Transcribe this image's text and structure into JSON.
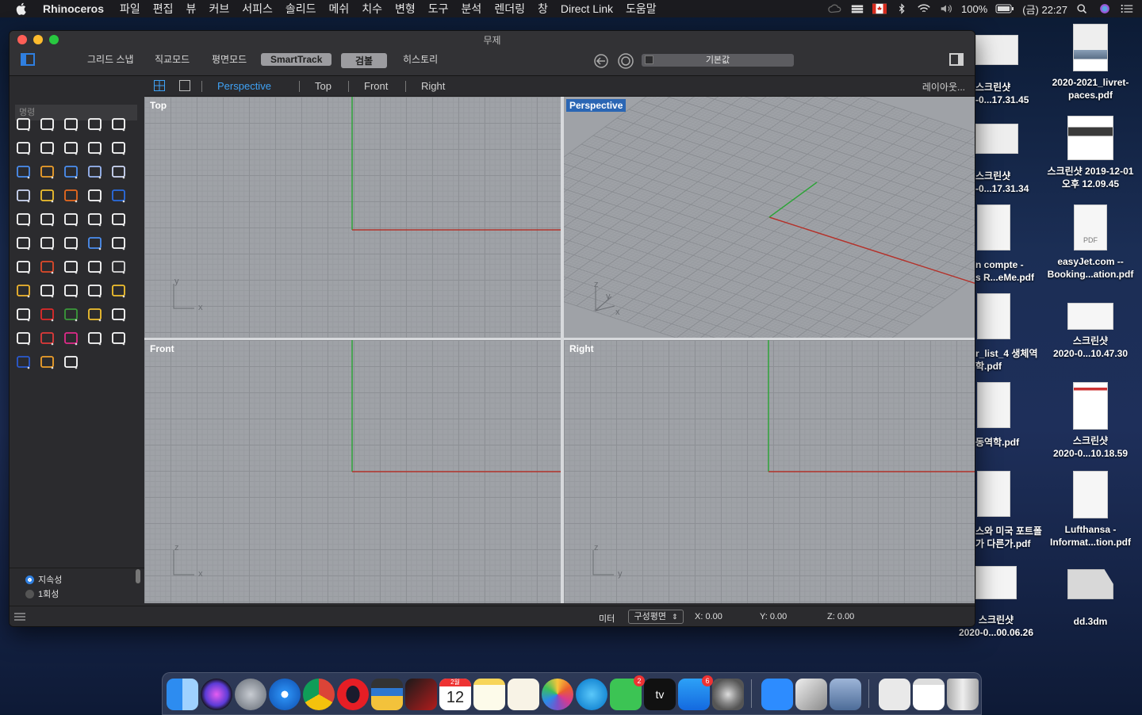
{
  "menubar": {
    "app": "Rhinoceros",
    "items": [
      "파일",
      "편집",
      "뷰",
      "커브",
      "서피스",
      "솔리드",
      "메쉬",
      "치수",
      "변형",
      "도구",
      "분석",
      "렌더링",
      "창",
      "Direct Link",
      "도움말"
    ],
    "battery": "100%",
    "clock": "(금) 22:27"
  },
  "window": {
    "title": "무제",
    "toolbar": {
      "grid_snap": "그리드 스냅",
      "ortho": "직교모드",
      "planar": "평면모드",
      "smarttrack": "SmartTrack",
      "gumball": "검볼",
      "history": "히스토리"
    },
    "layer": "기본값"
  },
  "sidebar": {
    "command_placeholder": "명령",
    "radio": [
      "지속성",
      "1회성"
    ]
  },
  "viewport_tabs": [
    "Perspective",
    "Top",
    "Front",
    "Right"
  ],
  "layout_button": "레이아웃...",
  "viewports": {
    "top": "Top",
    "perspective": "Perspective",
    "front": "Front",
    "right": "Right"
  },
  "axes": {
    "top": [
      "y",
      "x"
    ],
    "persp": [
      "z",
      "y",
      "x"
    ],
    "front": [
      "z",
      "x"
    ],
    "right": [
      "z",
      "y"
    ]
  },
  "status": {
    "unit": "미터",
    "cplane": "구성평면",
    "x": "X: 0.00",
    "y": "Y: 0.00",
    "z": "Z: 0.00"
  },
  "desktop": {
    "right": [
      [
        "2020-2021_livret-",
        "paces.pdf"
      ],
      [
        "스크린샷 2019-12-01",
        "오후 12.09.45"
      ],
      [
        "easyJet.com --",
        "Booking...ation.pdf"
      ],
      [
        "스크린샷",
        "2020-0...10.47.30"
      ],
      [
        "스크린샷",
        "2020-0...10.18.59"
      ],
      [
        "Lufthansa -",
        "Informat...tion.pdf"
      ],
      [
        "dd.3dm"
      ]
    ],
    "left": [
      [
        "스크린샷",
        "-0...17.31.45"
      ],
      [
        "스크린샷",
        "-0...17.31.34"
      ],
      [
        "n compte -",
        "s R...eMe.pdf"
      ],
      [
        "r_list_4 생체역",
        "학.pdf"
      ],
      [
        "동역학.pdf"
      ],
      [
        "스와 미국 포트폴",
        "가 다른가.pdf"
      ],
      [
        "스크린샷",
        "2020-0...00.06.26"
      ]
    ],
    "pdf_label": "PDF"
  },
  "dock": {
    "calendar_month": "2월",
    "calendar_day": "12",
    "facetime_badge": "2",
    "appstore_badge": "6",
    "tv_label": "tv"
  },
  "colors": {
    "accent": "#3fa2f5",
    "active_label": "#2a66b4",
    "x_axis": "#b3342d",
    "y_axis": "#2fa33a"
  }
}
